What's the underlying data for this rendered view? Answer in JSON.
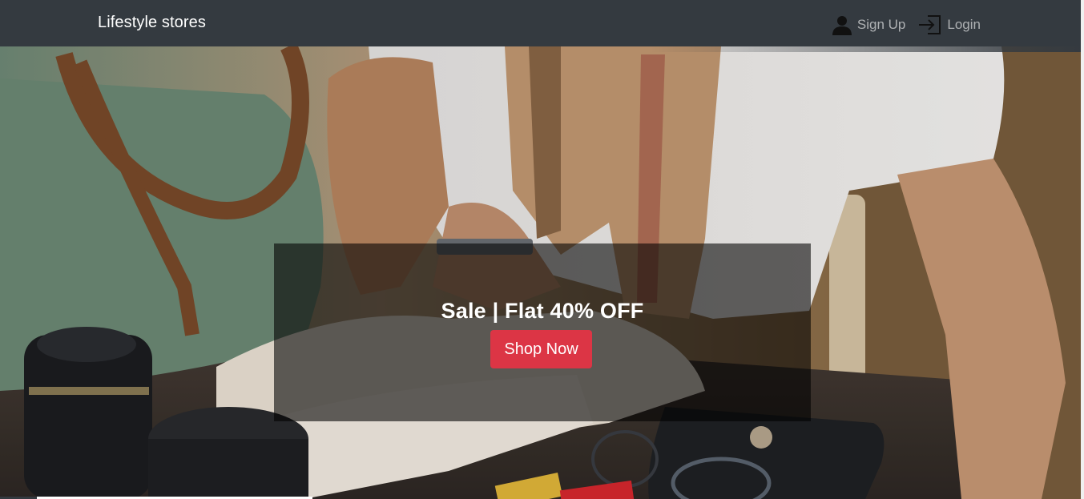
{
  "navbar": {
    "brand": "Lifestyle stores",
    "signup_label": "Sign Up",
    "login_label": "Login",
    "signup_icon": "user-icon",
    "login_icon": "login-icon"
  },
  "hero": {
    "banner_title": "Sale | Flat 40% OFF",
    "cta_label": "Shop Now"
  },
  "colors": {
    "navbar_bg": "#343a40",
    "cta_bg": "#dc3545",
    "nav_link": "rgba(255,255,255,0.6)"
  }
}
